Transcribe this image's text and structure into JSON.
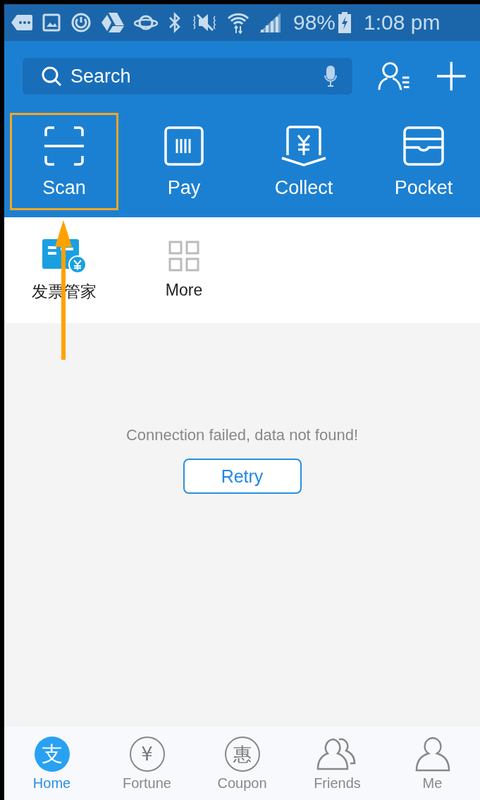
{
  "status_bar": {
    "battery": "98%",
    "time": "1:08 pm"
  },
  "search": {
    "placeholder": "Search"
  },
  "quick_actions": [
    {
      "label": "Scan",
      "kind": "scan",
      "highlighted": true
    },
    {
      "label": "Pay",
      "kind": "pay",
      "highlighted": false
    },
    {
      "label": "Collect",
      "kind": "collect",
      "highlighted": false
    },
    {
      "label": "Pocket",
      "kind": "pocket",
      "highlighted": false
    }
  ],
  "apps": [
    {
      "label": "发票管家",
      "kind": "invoice"
    },
    {
      "label": "More",
      "kind": "more"
    }
  ],
  "error": {
    "message": "Connection failed, data not found!",
    "button": "Retry"
  },
  "tabs": [
    {
      "label": "Home",
      "glyph": "支",
      "selected": true
    },
    {
      "label": "Fortune",
      "glyph": "¥",
      "selected": false
    },
    {
      "label": "Coupon",
      "glyph": "惠",
      "selected": false
    },
    {
      "label": "Friends",
      "selected": false
    },
    {
      "label": "Me",
      "selected": false
    }
  ]
}
